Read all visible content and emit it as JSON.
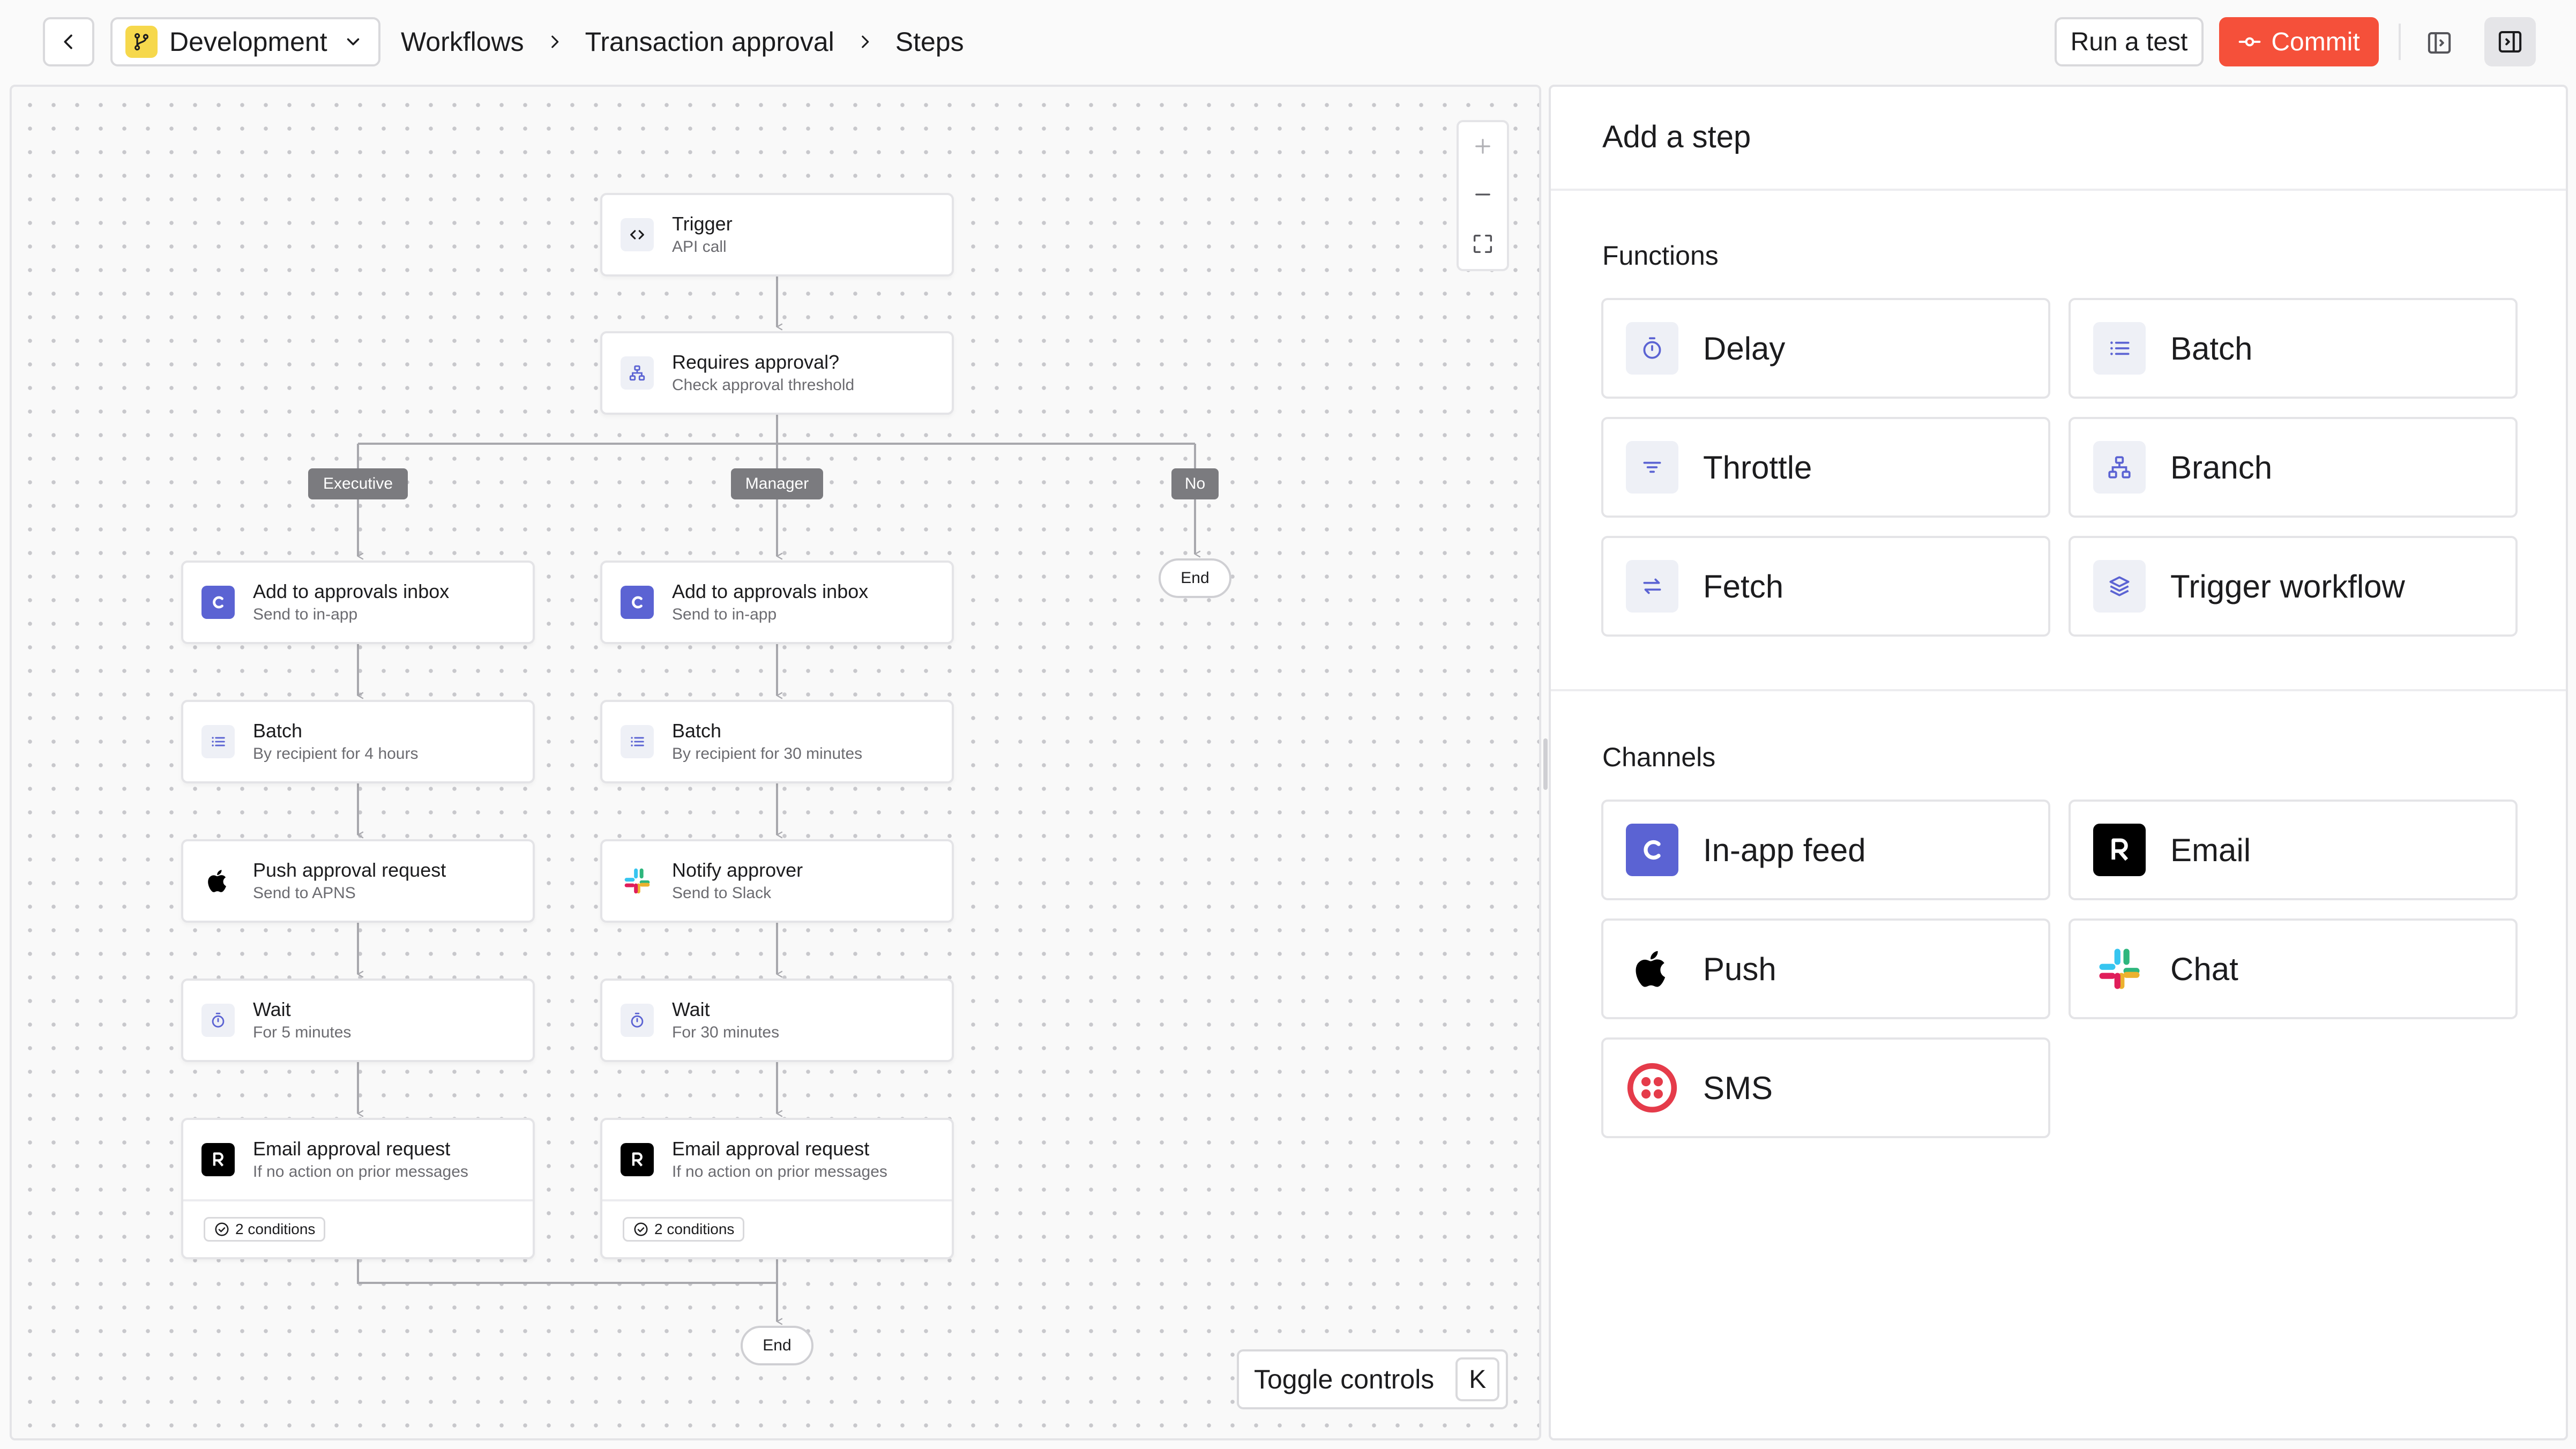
{
  "header": {
    "environment": "Development",
    "breadcrumb": [
      "Workflows",
      "Transaction approval",
      "Steps"
    ],
    "run_test_label": "Run a test",
    "commit_label": "Commit"
  },
  "canvas": {
    "nodes": {
      "trigger": {
        "title": "Trigger",
        "subtitle": "API call"
      },
      "requires_approval": {
        "title": "Requires approval?",
        "subtitle": "Check approval threshold"
      },
      "exec_inbox": {
        "title": "Add to approvals inbox",
        "subtitle": "Send to in-app"
      },
      "exec_batch": {
        "title": "Batch",
        "subtitle": "By recipient for 4 hours"
      },
      "exec_push": {
        "title": "Push approval request",
        "subtitle": "Send to APNS"
      },
      "exec_wait": {
        "title": "Wait",
        "subtitle": "For 5 minutes"
      },
      "exec_email": {
        "title": "Email approval request",
        "subtitle": "If no action on prior messages",
        "conditions": "2 conditions"
      },
      "mgr_inbox": {
        "title": "Add to approvals inbox",
        "subtitle": "Send to in-app"
      },
      "mgr_batch": {
        "title": "Batch",
        "subtitle": "By recipient for 30 minutes"
      },
      "mgr_notify": {
        "title": "Notify approver",
        "subtitle": "Send to Slack"
      },
      "mgr_wait": {
        "title": "Wait",
        "subtitle": "For 30 minutes"
      },
      "mgr_email": {
        "title": "Email approval request",
        "subtitle": "If no action on prior messages",
        "conditions": "2 conditions"
      }
    },
    "branches": {
      "executive": "Executive",
      "manager": "Manager",
      "no": "No"
    },
    "end_label": "End",
    "toggle_controls": {
      "label": "Toggle controls",
      "shortcut": "K"
    }
  },
  "panel": {
    "title": "Add a step",
    "functions_title": "Functions",
    "functions": [
      {
        "label": "Delay",
        "icon": "timer-icon"
      },
      {
        "label": "Batch",
        "icon": "list-icon"
      },
      {
        "label": "Throttle",
        "icon": "filter-icon"
      },
      {
        "label": "Branch",
        "icon": "branch-icon"
      },
      {
        "label": "Fetch",
        "icon": "arrows-swap-icon"
      },
      {
        "label": "Trigger workflow",
        "icon": "layers-icon"
      }
    ],
    "channels_title": "Channels",
    "channels": [
      {
        "label": "In-app feed",
        "icon": "courier-c-icon",
        "color": "#5b63d3"
      },
      {
        "label": "Email",
        "icon": "resend-r-icon",
        "color": "#000000"
      },
      {
        "label": "Push",
        "icon": "apple-icon",
        "color": "#000000"
      },
      {
        "label": "Chat",
        "icon": "slack-icon",
        "color": "#4a154b"
      },
      {
        "label": "SMS",
        "icon": "twilio-icon",
        "color": "#e53b4a"
      }
    ]
  },
  "colors": {
    "accent": "#f5503a",
    "env_badge": "#f6d84c",
    "branch_label": "#7b7b7f"
  }
}
